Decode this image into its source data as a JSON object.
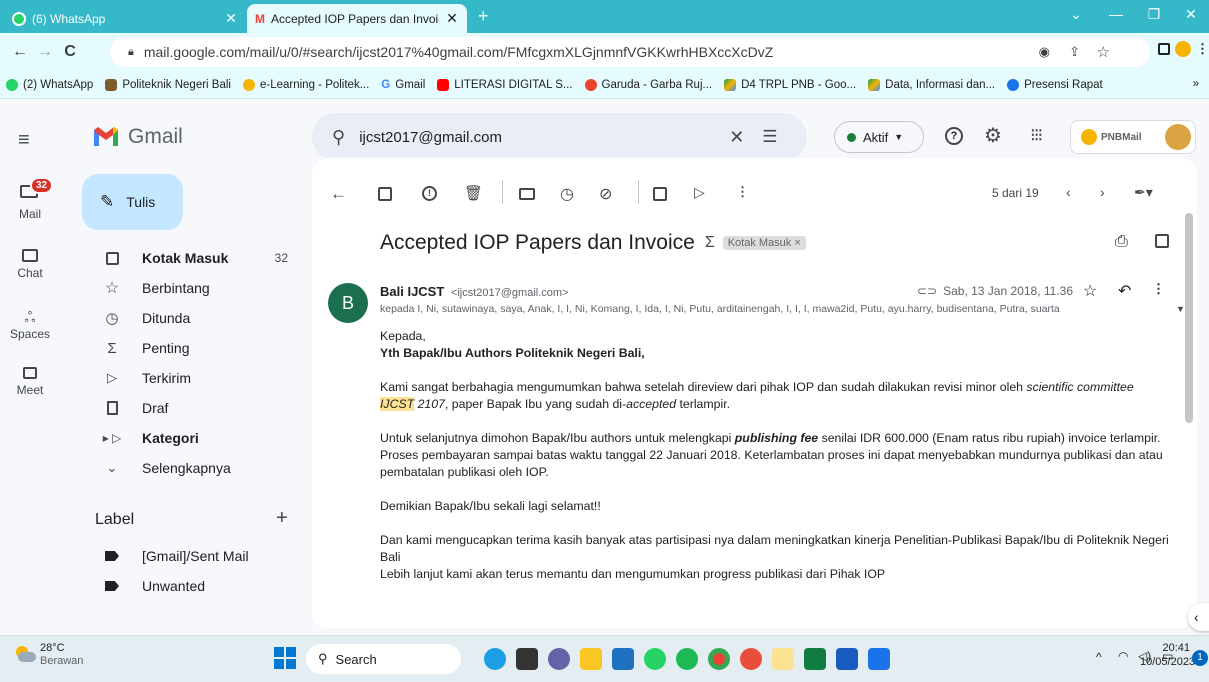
{
  "browser": {
    "tabs": [
      {
        "title": "(6) WhatsApp"
      },
      {
        "title": "Accepted IOP Papers dan Invoice"
      }
    ],
    "url": "mail.google.com/mail/u/0/#search/ijcst2017%40gmail.com/FMfcgxmXLGjnmnfVGKKwrhHBXccXcDvZ",
    "bookmarks": [
      "(2) WhatsApp",
      "Politeknik Negeri Bali",
      "e-Learning - Politek...",
      "Gmail",
      "LITERASI DIGITAL S...",
      "Garuda - Garba Ruj...",
      "D4 TRPL PNB - Goo...",
      "Data, Informasi dan...",
      "Presensi Rapat"
    ],
    "more_bookmarks": "»"
  },
  "gmail": {
    "logo_text": "Gmail",
    "search_value": "ijcst2017@gmail.com",
    "status_label": "Aktif",
    "account_logo": "PNBMail",
    "rail": {
      "mail": "Mail",
      "mail_badge": "32",
      "chat": "Chat",
      "spaces": "Spaces",
      "meet": "Meet"
    },
    "compose": "Tulis",
    "nav": [
      {
        "label": "Kotak Masuk",
        "count": "32",
        "icon": "inbox-icon"
      },
      {
        "label": "Berbintang",
        "count": "",
        "icon": "star-icon"
      },
      {
        "label": "Ditunda",
        "count": "",
        "icon": "clock-icon"
      },
      {
        "label": "Penting",
        "count": "",
        "icon": "important-icon"
      },
      {
        "label": "Terkirim",
        "count": "",
        "icon": "send-icon"
      },
      {
        "label": "Draf",
        "count": "",
        "icon": "draft-icon"
      },
      {
        "label": "Kategori",
        "count": "",
        "icon": "label-icon"
      },
      {
        "label": "Selengkapnya",
        "count": "",
        "icon": "chevron-down-icon"
      }
    ],
    "labels_heading": "Label",
    "labels": [
      "[Gmail]/Sent Mail",
      "Unwanted"
    ],
    "pager": "5 dari 19"
  },
  "email": {
    "subject": "Accepted IOP Papers dan Invoice",
    "tag": "Kotak Masuk",
    "avatar_letter": "B",
    "sender_name": "Bali IJCST",
    "sender_email": "<ijcst2017@gmail.com>",
    "date": "Sab, 13 Jan 2018, 11.36",
    "recipients": "kepada I, Ni, sutawinaya, saya, Anak, I, I, Ni, Komang, I, Ida, I, Ni, Putu, arditainengah, I, I, I, mawa2id, Putu, ayu.harry, budisentana, Putra, suarta",
    "greeting": "Kepada,",
    "salutation": "Yth Bapak/Ibu Authors Politeknik Negeri Bali,",
    "p1_a": "Kami sangat berbahagia mengumumkan bahwa setelah direview dari pihak IOP dan sudah dilakukan revisi minor oleh ",
    "p1_em": "scientific committee",
    "p1_hl": "IJCST",
    "p1_b": " 2107",
    "p1_c": ", paper  Bapak Ibu yang sudah di-",
    "p1_acc": "accepted",
    "p1_d": " terlampir.",
    "p2_a": "Untuk selanjutnya dimohon Bapak/Ibu authors untuk melengkapi ",
    "p2_fee": "publishing fee",
    "p2_b": " senilai IDR 600.000 (Enam ratus ribu rupiah) invoice terlampir. Proses pembayaran sampai batas waktu tanggal 22 Januari 2018. Keterlambatan proses ini dapat menyebabkan mundurnya publikasi dan atau pembatalan publikasi oleh IOP.",
    "p3": "Demikian Bapak/Ibu sekali lagi selamat!!",
    "p4": "Dan kami mengucapkan terima kasih banyak atas partisipasi nya dalam meningkatkan kinerja Penelitian-Publikasi Bapak/Ibu di Politeknik Negeri Bali",
    "p5": "Lebih lanjut kami akan terus memantu dan mengumumkan  progress publikasi dari Pihak IOP"
  },
  "taskbar": {
    "temp": "28°C",
    "weather": "Berawan",
    "search": "Search",
    "time": "20:41",
    "date": "10/05/2023",
    "notif": "1"
  },
  "colors": {
    "tabstrip": "#35b8c7",
    "toolbar": "#e6fbfd",
    "gmail_bg": "#f6f8fc",
    "compose": "#c2e7ff",
    "avatar": "#1b6e4e",
    "status_dot": "#188038"
  }
}
